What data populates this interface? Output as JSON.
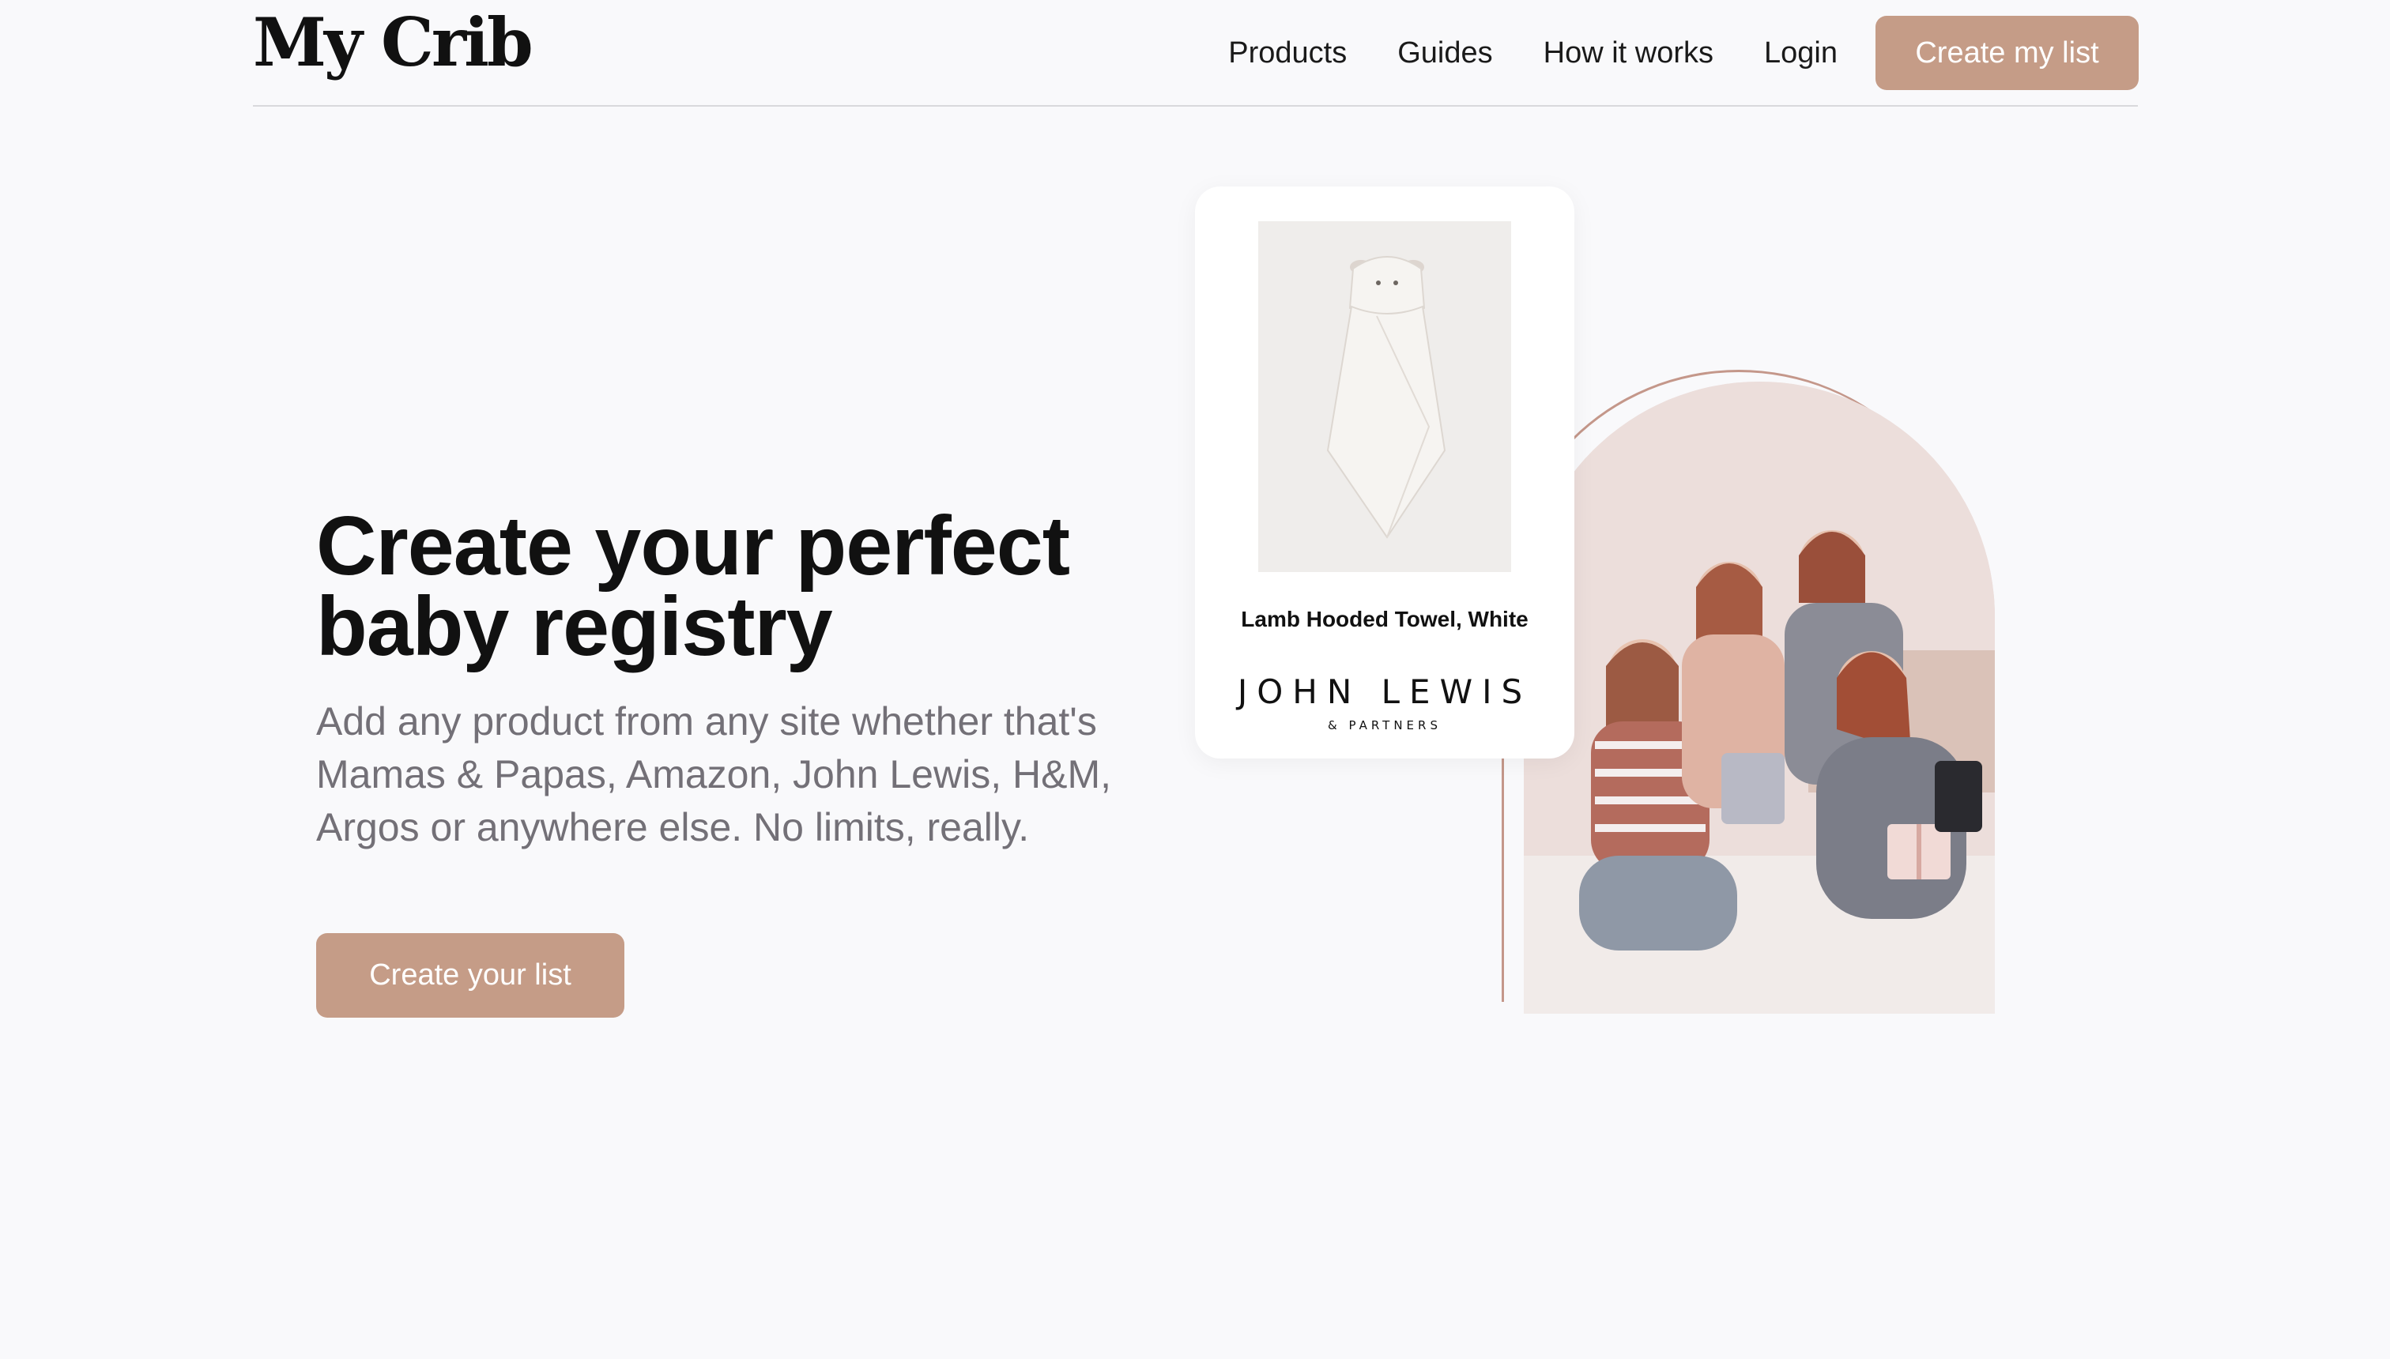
{
  "header": {
    "logo": "My Crib",
    "nav": [
      "Products",
      "Guides",
      "How it works",
      "Login"
    ],
    "cta": "Create my list"
  },
  "hero": {
    "title": "Create your perfect baby registry",
    "subtitle": "Add any product from any site whether that's Mamas & Papas, Amazon, John Lewis, H&M, Argos or anywhere else. No limits, really.",
    "cta": "Create your list"
  },
  "product_card": {
    "name": "Lamb Hooded Towel, White",
    "brand": "JOHN LEWIS",
    "brand_sub": "& PARTNERS"
  },
  "colors": {
    "accent": "#c59c87",
    "background": "#f9f9fb",
    "subtitle": "#737077"
  }
}
